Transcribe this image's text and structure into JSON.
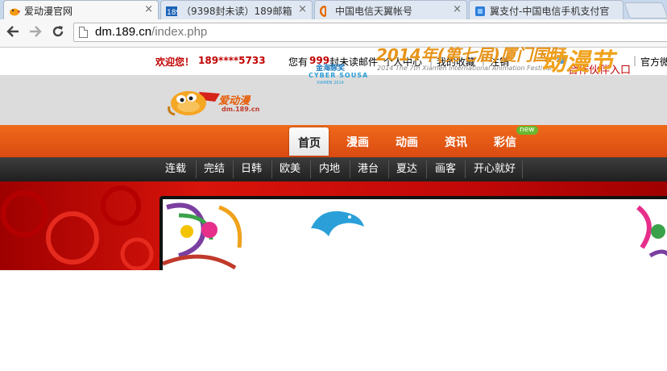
{
  "browser": {
    "tabs": [
      {
        "title": "爱动漫官网",
        "active": true,
        "favicon": "duck-favicon"
      },
      {
        "title": "（9398封未读）189邮箱",
        "active": false,
        "favicon": "189-favicon"
      },
      {
        "title": "中国电信天翼帐号",
        "active": false,
        "favicon": "telecom-favicon"
      },
      {
        "title": "翼支付-中国电信手机支付官",
        "active": false,
        "favicon": "bestpay-favicon"
      }
    ],
    "close_glyph": "×",
    "url_host": "dm.189.cn",
    "url_path": "/index.php",
    "icons": {
      "back": "arrow-left",
      "forward": "arrow-right",
      "reload": "reload"
    }
  },
  "topbar": {
    "welcome": "欢迎您！",
    "user": "189****5733",
    "mail_prefix": "您有",
    "mail_count": "999",
    "mail_suffix": "封未读邮件",
    "links": [
      "个人中心",
      "我的收藏",
      "注销"
    ],
    "partner": "合作伙伴入口",
    "official": "官方微"
  },
  "logo": {
    "brand": "爱动漫",
    "domain": "dm.189.cn"
  },
  "nav": {
    "items": [
      "首页",
      "漫画",
      "动画",
      "资讯",
      "彩信"
    ],
    "active": "首页",
    "new_badge": "new"
  },
  "subnav": {
    "items": [
      "连载",
      "完结",
      "日韩",
      "欧美",
      "内地",
      "港台",
      "夏达",
      "画客",
      "开心就好"
    ]
  },
  "banner": {
    "title": "2014年(第七届)厦门国际",
    "highlight": "动漫节",
    "subtitle": "2014 The 7th Xiamen International Animation Festival",
    "award_cn": "金海豚奖",
    "award_en": "CYBER SOUSA",
    "award_small": "XIAMEN 2014"
  },
  "colors": {
    "accent_orange": "#e85a15",
    "welcome_red": "#c00000",
    "festival_orange": "#e7941a",
    "dolphin_blue": "#1e7cc0"
  }
}
